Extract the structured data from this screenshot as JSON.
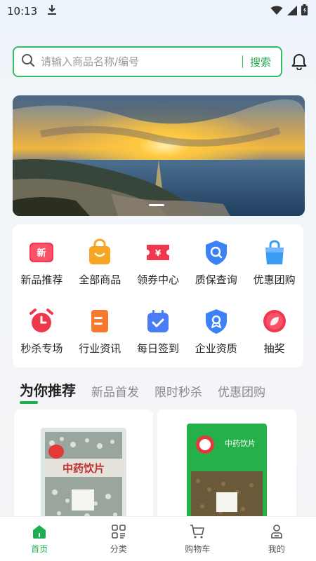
{
  "status_bar": {
    "time": "10:13"
  },
  "search": {
    "placeholder": "请输入商品名称/编号",
    "button_label": "搜索"
  },
  "categories": [
    {
      "label": "新品推荐",
      "icon": "new-products-icon",
      "color": "#f0384c"
    },
    {
      "label": "全部商品",
      "icon": "shopping-bag-icon",
      "color": "#f6a623"
    },
    {
      "label": "领券中心",
      "icon": "coupon-icon",
      "color": "#f0384c"
    },
    {
      "label": "质保查询",
      "icon": "quality-search-shield-icon",
      "color": "#3b82f6"
    },
    {
      "label": "优惠团购",
      "icon": "group-buy-bag-icon",
      "color": "#3b9cf5"
    },
    {
      "label": "秒杀专场",
      "icon": "alarm-clock-icon",
      "color": "#f0384c"
    },
    {
      "label": "行业资讯",
      "icon": "news-document-icon",
      "color": "#f57a2f"
    },
    {
      "label": "每日签到",
      "icon": "calendar-checkin-icon",
      "color": "#4a7cf5"
    },
    {
      "label": "企业资质",
      "icon": "certificate-shield-icon",
      "color": "#3b82f6"
    },
    {
      "label": "抽奖",
      "icon": "lottery-icon",
      "color": "#f0384c"
    }
  ],
  "tabs": [
    {
      "label": "为你推荐",
      "active": true
    },
    {
      "label": "新品首发",
      "active": false
    },
    {
      "label": "限时秒杀",
      "active": false
    },
    {
      "label": "优惠团购",
      "active": false
    }
  ],
  "products": [
    {
      "package_text": "中药饮片"
    },
    {
      "package_text": "中药饮片"
    }
  ],
  "bottom_nav": [
    {
      "label": "首页",
      "icon": "home-icon",
      "active": true
    },
    {
      "label": "分类",
      "icon": "category-icon",
      "active": false
    },
    {
      "label": "购物车",
      "icon": "cart-icon",
      "active": false
    },
    {
      "label": "我的",
      "icon": "profile-icon",
      "active": false
    }
  ],
  "colors": {
    "accent": "#1fae4f"
  }
}
